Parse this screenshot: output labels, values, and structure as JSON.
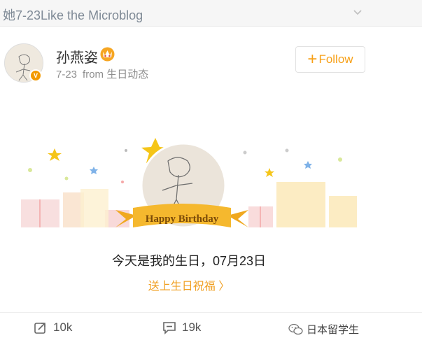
{
  "header": {
    "title": "她7-23Like the Microblog",
    "expand_icon": "chevron-down-icon"
  },
  "post": {
    "username": "孙燕姿",
    "badge_icon": "vip-crown-icon",
    "verified_label": "V",
    "time": "7-23",
    "source": "from 生日动态",
    "follow_label": "Follow",
    "banner_label": "Happy Birthday",
    "birthday_text": "今天是我的生日，07月23日",
    "bless_link": "送上生日祝福 〉"
  },
  "actions": {
    "repost_count": "10k",
    "comment_count": "19k"
  },
  "watermark": {
    "label": "日本留学生"
  },
  "colors": {
    "accent": "#f7a017",
    "banner": "#f5b82e",
    "muted_text": "#8e8e8e"
  }
}
